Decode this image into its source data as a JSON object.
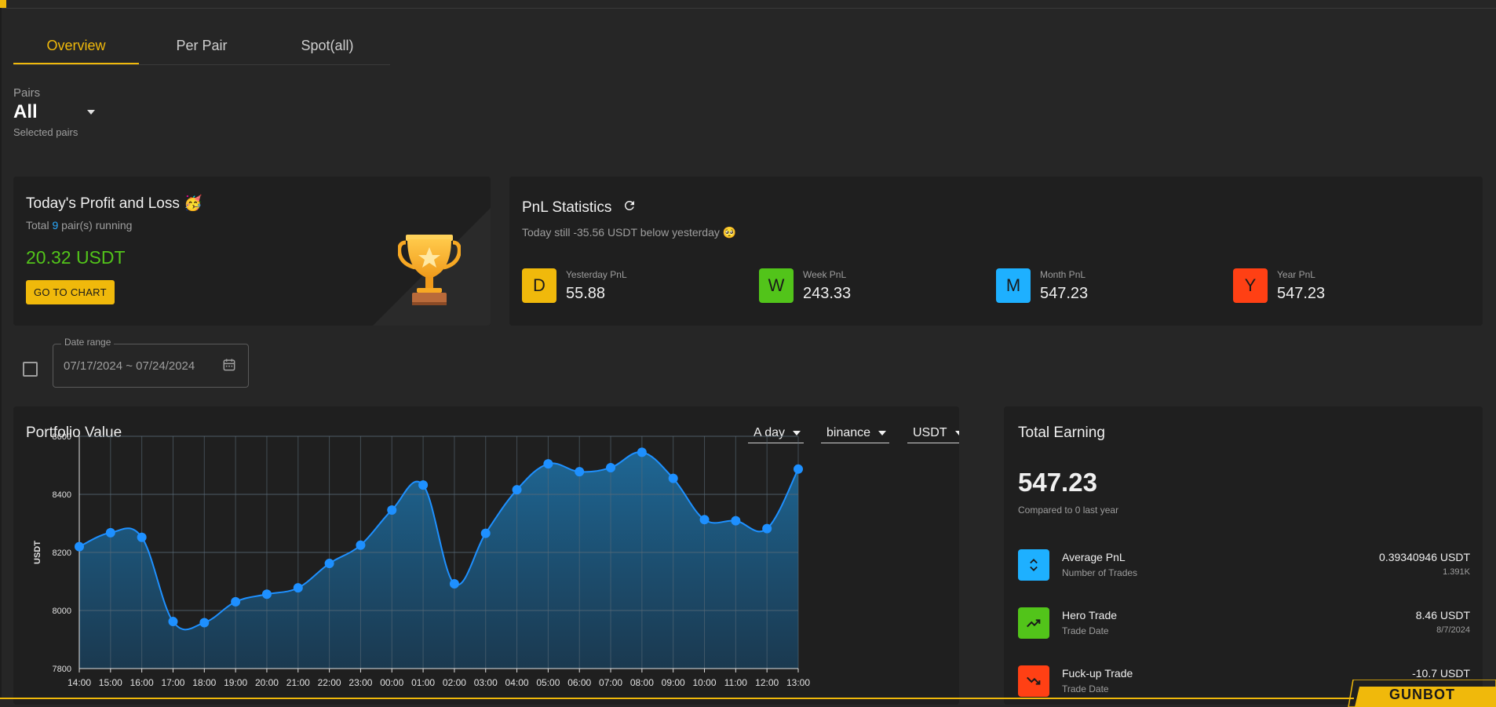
{
  "tabs": [
    {
      "label": "Overview",
      "active": true
    },
    {
      "label": "Per Pair",
      "active": false
    },
    {
      "label": "Spot(all)",
      "active": false
    }
  ],
  "pairs": {
    "label": "Pairs",
    "value": "All",
    "helper": "Selected pairs"
  },
  "profit_loss": {
    "title": "Today's Profit and Loss 🥳",
    "sub_prefix": "Total ",
    "sub_count": "9",
    "sub_suffix": " pair(s) running",
    "value": "20.32 USDT",
    "button": "GO TO CHART",
    "icon": "trophy-icon"
  },
  "pnl_stats": {
    "title": "PnL Statistics",
    "subtitle": "Today still -35.56 USDT below yesterday 🥺",
    "items": [
      {
        "letter": "D",
        "label": "Yesterday PnL",
        "value": "55.88",
        "color": "#f0b90b"
      },
      {
        "letter": "W",
        "label": "Week PnL",
        "value": "243.33",
        "color": "#52c41a"
      },
      {
        "letter": "M",
        "label": "Month PnL",
        "value": "547.23",
        "color": "#1eb0ff"
      },
      {
        "letter": "Y",
        "label": "Year PnL",
        "value": "547.23",
        "color": "#ff4014"
      }
    ]
  },
  "date_range": {
    "label": "Date range",
    "value": "07/17/2024 ~ 07/24/2024"
  },
  "portfolio": {
    "title": "Portfolio Value",
    "period": "A day",
    "exchange": "binance",
    "currency": "USDT"
  },
  "chart_data": {
    "type": "area",
    "ylabel": "USDT",
    "ylim": [
      7800,
      8600
    ],
    "yticks": [
      7800,
      8000,
      8200,
      8400,
      8600
    ],
    "x": [
      "14:00",
      "15:00",
      "16:00",
      "17:00",
      "18:00",
      "19:00",
      "20:00",
      "21:00",
      "22:00",
      "23:00",
      "00:00",
      "01:00",
      "02:00",
      "03:00",
      "04:00",
      "05:00",
      "06:00",
      "07:00",
      "08:00",
      "09:00",
      "10:00",
      "11:00",
      "12:00",
      "13:00"
    ],
    "values": [
      8220,
      8268,
      8252,
      7962,
      7958,
      8030,
      8056,
      8078,
      8162,
      8225,
      8346,
      8432,
      8092,
      8266,
      8416,
      8505,
      8478,
      8492,
      8545,
      8455,
      8313,
      8309,
      8282,
      8487
    ],
    "grid": true,
    "color": "#1e90ff"
  },
  "total_earning": {
    "title": "Total Earning",
    "value": "547.23",
    "subtitle": "Compared to 0 last year",
    "rows": [
      {
        "name": "Average PnL",
        "sub": "Number of Trades",
        "value": "0.39340946 USDT",
        "value_sub": "1.391K",
        "color": "#1eb0ff",
        "icon": "unfold-icon"
      },
      {
        "name": "Hero Trade",
        "sub": "Trade Date",
        "value": "8.46 USDT",
        "value_sub": "8/7/2024",
        "color": "#52c41a",
        "icon": "trending-up-icon"
      },
      {
        "name": "Fuck-up Trade",
        "sub": "Trade Date",
        "value": "-10.7 USDT",
        "value_sub": "",
        "color": "#ff4014",
        "icon": "trending-down-icon"
      }
    ]
  },
  "brand": {
    "name": "GUNBOT",
    "color": "#f0b90b"
  }
}
